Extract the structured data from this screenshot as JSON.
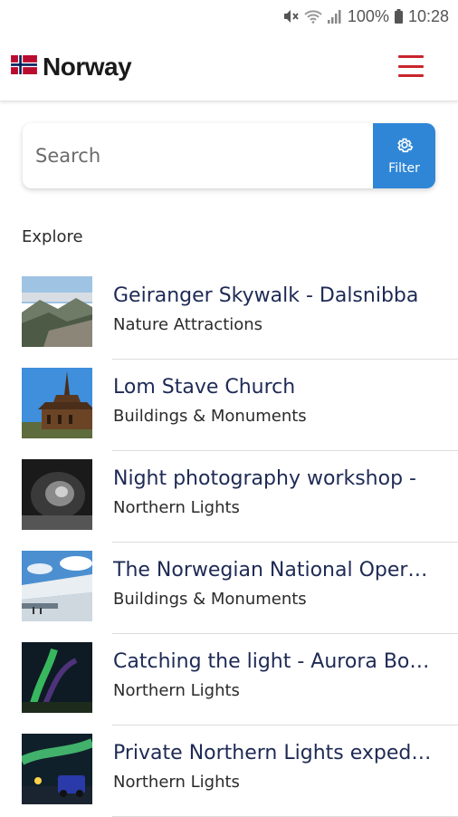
{
  "status_bar": {
    "battery": "100%",
    "time": "10:28"
  },
  "header": {
    "title": "Norway",
    "flag_icon": "norway-flag-icon",
    "menu_icon": "hamburger-menu-icon",
    "menu_color": "#c9252c"
  },
  "search": {
    "placeholder": "Search",
    "filter_label": "Filter",
    "filter_color": "#2f86d6"
  },
  "explore": {
    "title": "Explore",
    "items": [
      {
        "title": "Geiranger Skywalk - Dalsnibba",
        "category": "Nature Attractions"
      },
      {
        "title": "Lom Stave Church",
        "category": "Buildings & Monuments"
      },
      {
        "title": "Night photography workshop -",
        "category": "Northern Lights"
      },
      {
        "title": "The Norwegian National Oper…",
        "category": "Buildings & Monuments"
      },
      {
        "title": "Catching the light - Aurora Bo…",
        "category": "Northern Lights"
      },
      {
        "title": "Private Northern Lights exped…",
        "category": "Northern Lights"
      }
    ]
  }
}
